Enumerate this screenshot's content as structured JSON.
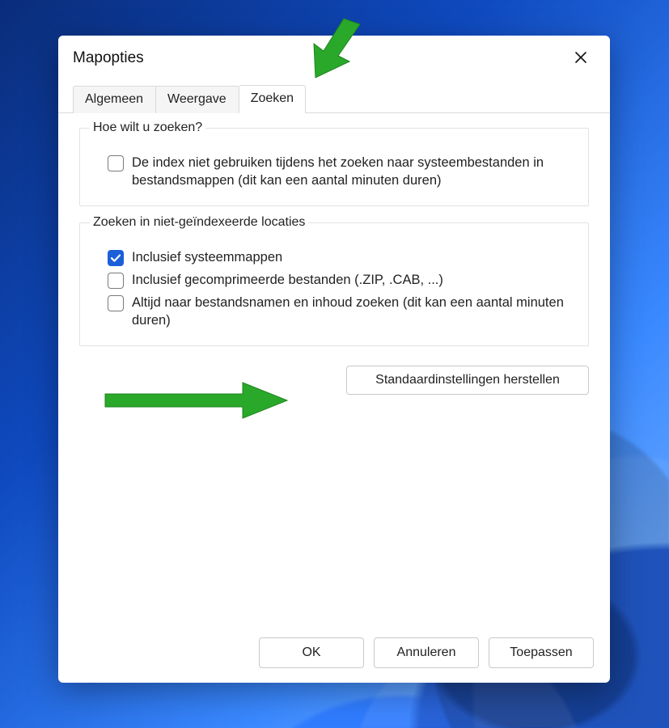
{
  "dialog": {
    "title": "Mapopties",
    "close_aria": "Sluiten"
  },
  "tabs": {
    "general": "Algemeen",
    "view": "Weergave",
    "search": "Zoeken",
    "active": "search"
  },
  "search_panel": {
    "group1": {
      "legend": "Hoe wilt u zoeken?",
      "opt_no_index": {
        "label": "De index niet gebruiken tijdens het zoeken naar systeembestanden in bestandsmappen (dit kan een aantal minuten duren)",
        "checked": false
      }
    },
    "group2": {
      "legend": "Zoeken in niet-geïndexeerde locaties",
      "opt_sysfolders": {
        "label": "Inclusief systeemmappen",
        "checked": true
      },
      "opt_compressed": {
        "label": "Inclusief gecomprimeerde bestanden (.ZIP, .CAB, ...)",
        "checked": false
      },
      "opt_always_names": {
        "label": "Altijd naar bestandsnamen en inhoud zoeken (dit kan een aantal minuten duren)",
        "checked": false
      }
    },
    "restore_defaults": "Standaardinstellingen herstellen"
  },
  "footer": {
    "ok": "OK",
    "cancel": "Annuleren",
    "apply": "Toepassen"
  }
}
